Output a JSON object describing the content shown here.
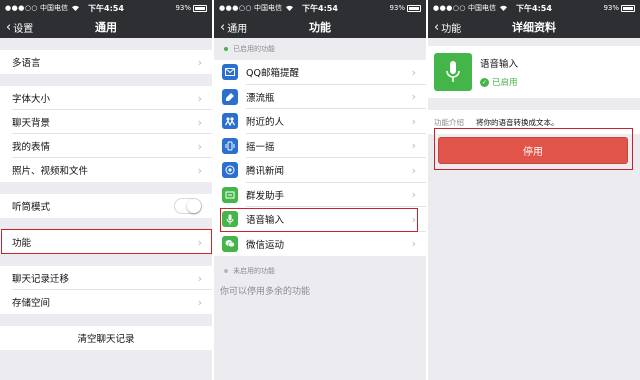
{
  "status": {
    "signal": "●●●○○",
    "carrier": "中国电信",
    "time": "下午4:54",
    "battery": "93%"
  },
  "colors": {
    "nav_bg": "#2d2f33",
    "accent_green": "#44b548",
    "danger_red": "#e0544a",
    "highlight": "#c8232c"
  },
  "panel1": {
    "back": "设置",
    "title": "通用",
    "items": {
      "language": "多语言",
      "font_size": "字体大小",
      "chat_background": "聊天背景",
      "my_stickers": "我的表情",
      "media": "照片、视频和文件",
      "earpiece_mode": "听筒模式",
      "features": "功能",
      "chat_migration": "聊天记录迁移",
      "storage": "存储空间",
      "clear_history": "清空聊天记录"
    },
    "earpiece_mode_on": false
  },
  "panel2": {
    "back": "通用",
    "title": "功能",
    "enabled_label": "已启用的功能",
    "enabled": [
      {
        "label": "QQ邮箱提醒",
        "icon": "mail-icon",
        "color": "#2b6fcf"
      },
      {
        "label": "漂流瓶",
        "icon": "bottle-icon",
        "color": "#2b6fcf"
      },
      {
        "label": "附近的人",
        "icon": "people-nearby-icon",
        "color": "#2b6fcf"
      },
      {
        "label": "摇一摇",
        "icon": "shake-icon",
        "color": "#2b6fcf"
      },
      {
        "label": "腾讯新闻",
        "icon": "news-icon",
        "color": "#2b6fcf"
      },
      {
        "label": "群发助手",
        "icon": "broadcast-icon",
        "color": "#44b548"
      },
      {
        "label": "语音输入",
        "icon": "microphone-icon",
        "color": "#44b548"
      },
      {
        "label": "微信运动",
        "icon": "wechat-sport-icon",
        "color": "#44b548"
      }
    ],
    "disabled_label": "未启用的功能",
    "disabled_hint": "你可以停用多余的功能"
  },
  "panel3": {
    "back": "功能",
    "title": "详细资料",
    "name": "语音输入",
    "status": "已启用",
    "intro_label": "功能介绍",
    "intro_text": "将你的语音转换成文本。",
    "disable_button": "停用"
  }
}
